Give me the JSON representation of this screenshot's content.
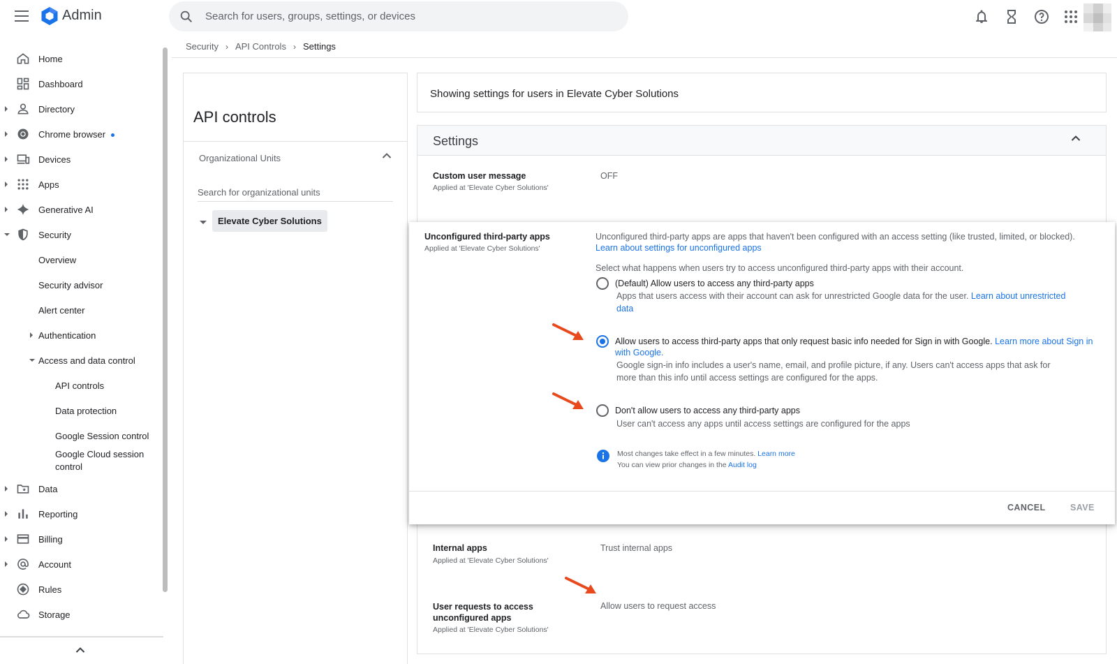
{
  "app": {
    "brand": "Admin"
  },
  "search": {
    "placeholder": "Search for users, groups, settings, or devices"
  },
  "breadcrumb": {
    "items": [
      "Security",
      "API Controls"
    ],
    "current": "Settings"
  },
  "sidebar": {
    "items": [
      {
        "label": "Home",
        "icon": "home-icon"
      },
      {
        "label": "Dashboard",
        "icon": "dashboard-icon"
      },
      {
        "label": "Directory",
        "icon": "person-icon"
      },
      {
        "label": "Chrome browser",
        "icon": "chrome-icon"
      },
      {
        "label": "Devices",
        "icon": "devices-icon"
      },
      {
        "label": "Apps",
        "icon": "apps-grid-icon"
      },
      {
        "label": "Generative AI",
        "icon": "sparkle-icon"
      },
      {
        "label": "Security",
        "icon": "shield-icon"
      },
      {
        "label": "Overview"
      },
      {
        "label": "Security advisor"
      },
      {
        "label": "Alert center"
      },
      {
        "label": "Authentication"
      },
      {
        "label": "Access and data control"
      },
      {
        "label": "API controls"
      },
      {
        "label": "Data protection"
      },
      {
        "label": "Google Session control"
      },
      {
        "label": "Google Cloud session control"
      },
      {
        "label": "Data",
        "icon": "folder-star-icon"
      },
      {
        "label": "Reporting",
        "icon": "bar-chart-icon"
      },
      {
        "label": "Billing",
        "icon": "credit-card-icon"
      },
      {
        "label": "Account",
        "icon": "at-sign-icon"
      },
      {
        "label": "Rules",
        "icon": "rules-icon"
      },
      {
        "label": "Storage",
        "icon": "cloud-icon"
      }
    ]
  },
  "ou_panel": {
    "title": "API controls",
    "header": "Organizational Units",
    "search_placeholder": "Search for organizational units",
    "node": "Elevate Cyber Solutions"
  },
  "showing": "Showing settings for users in Elevate Cyber Solutions",
  "settings": {
    "title": "Settings",
    "custom_message": {
      "label": "Custom user message",
      "applied": "Applied at 'Elevate Cyber Solutions'",
      "value": "OFF"
    },
    "internal_apps": {
      "label": "Internal apps",
      "applied": "Applied at 'Elevate Cyber Solutions'",
      "value": "Trust internal apps"
    },
    "user_requests": {
      "label": "User requests to access unconfigured apps",
      "applied": "Applied at 'Elevate Cyber Solutions'",
      "value": "Allow users to request access"
    }
  },
  "modal": {
    "label": "Unconfigured third-party apps",
    "applied": "Applied at 'Elevate Cyber Solutions'",
    "description": "Unconfigured third-party apps are apps that haven't been configured with an access setting (like trusted, limited, or blocked).",
    "description_link": "Learn about settings for unconfigured apps",
    "question": "Select what happens when users try to access unconfigured third-party apps with their account.",
    "options": [
      {
        "title": "(Default) Allow users to access any third-party apps",
        "desc": "Apps that users access with their account can ask for unrestricted Google data for the user.",
        "desc_link": "Learn about unrestricted data",
        "checked": false
      },
      {
        "title": "Allow users to access third-party apps that only request basic info needed for Sign in with Google.",
        "title_link": "Learn more about Sign in with Google.",
        "desc": "Google sign-in info includes a user's name, email, and profile picture, if any. Users can't access apps that ask for more than this info until access settings are configured for the apps.",
        "checked": true
      },
      {
        "title": "Don't allow users to access any third-party apps",
        "desc": "User can't access any apps until access settings are configured for the apps",
        "checked": false
      }
    ],
    "info_line1": "Most changes take effect in a few minutes.",
    "info_link1": "Learn more",
    "info_line2": "You can view prior changes in the",
    "info_link2": "Audit log",
    "cancel": "CANCEL",
    "save": "SAVE"
  },
  "colors": {
    "accent": "#1a73e8",
    "annotation_arrow": "#e8491d",
    "text": "#202124",
    "muted": "#5f6368"
  }
}
